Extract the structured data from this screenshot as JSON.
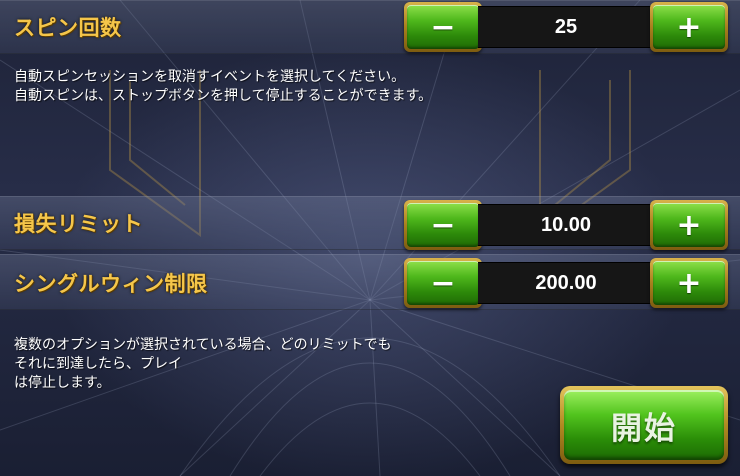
{
  "spin_count": {
    "label": "スピン回数",
    "value": "25",
    "minus_label": "−",
    "plus_label": "+"
  },
  "spin_info": {
    "line1": "自動スピンセッションを取消すイベントを選択してください。",
    "line2": "自動スピンは、ストップボタンを押して停止することができます。"
  },
  "loss_limit": {
    "label": "損失リミット",
    "value": "10.00",
    "minus_label": "−",
    "plus_label": "+"
  },
  "single_win_limit": {
    "label": "シングルウィン制限",
    "value": "200.00",
    "minus_label": "−",
    "plus_label": "+"
  },
  "limit_info": {
    "line1": "複数のオプションが選択されている場合、どのリミットでも",
    "line2": "それに到達したら、プレイ",
    "line3": "は停止します。"
  },
  "start_button": {
    "label": "開始"
  },
  "colors": {
    "label_gold": "#f5c64a",
    "button_green": "#4fb81c",
    "button_frame_gold": "#b08a22",
    "value_box_bg": "#161616"
  }
}
